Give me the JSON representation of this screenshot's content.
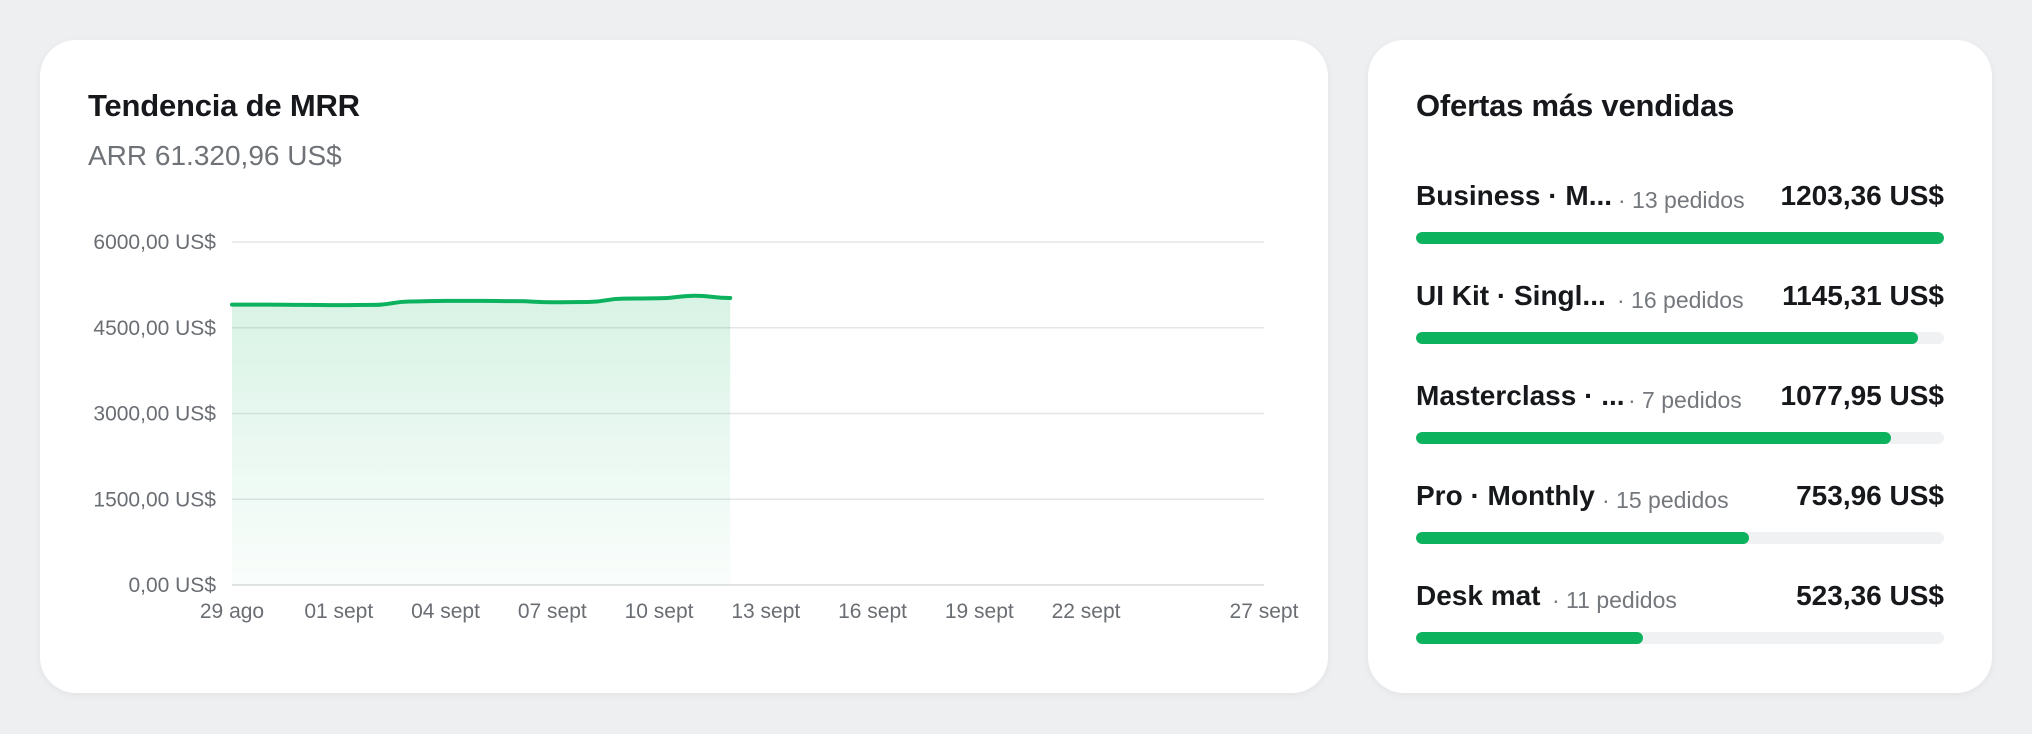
{
  "mrr_card": {
    "title": "Tendencia de MRR",
    "subtitle": "ARR 61.320,96 US$"
  },
  "chart_data": {
    "type": "area",
    "title": "Tendencia de MRR",
    "x_ticks": [
      "29 ago",
      "01 sept",
      "04 sept",
      "07 sept",
      "10 sept",
      "13 sept",
      "16 sept",
      "19 sept",
      "22 sept",
      "27 sept"
    ],
    "y_ticks": [
      "0,00 US$",
      "1500,00 US$",
      "3000,00 US$",
      "4500,00 US$",
      "6000,00 US$"
    ],
    "ylim": [
      0,
      6000
    ],
    "x_range": [
      "29 ago",
      "27 sept"
    ],
    "grid": true,
    "color": "#0cb25e",
    "series": [
      {
        "x": [
          "29 ago",
          "30 ago",
          "31 ago",
          "01 sept",
          "02 sept",
          "03 sept",
          "04 sept",
          "05 sept",
          "06 sept",
          "07 sept",
          "08 sept",
          "09 sept",
          "10 sept",
          "11 sept",
          "12 sept"
        ],
        "values": [
          4905,
          4905,
          4900,
          4895,
          4900,
          4960,
          4970,
          4970,
          4965,
          4945,
          4950,
          5010,
          5015,
          5060,
          5020
        ]
      }
    ]
  },
  "offers_card": {
    "title": "Ofertas más vendidas",
    "items": [
      {
        "name": "Business · M...",
        "orders": "· 13 pedidos",
        "amount": "1203,36 US$",
        "share": 1.0
      },
      {
        "name": "UI Kit · Singl...",
        "orders": "· 16 pedidos",
        "amount": "1145,31 US$",
        "share": 0.95
      },
      {
        "name": "Masterclass · ...",
        "orders": "· 7 pedidos",
        "amount": "1077,95 US$",
        "share": 0.9
      },
      {
        "name": "Pro · Monthly",
        "orders": "· 15 pedidos",
        "amount": "753,96 US$",
        "share": 0.63
      },
      {
        "name": "Desk mat",
        "orders": "· 11 pedidos",
        "amount": "523,36 US$",
        "share": 0.43
      }
    ],
    "bar_color": "#0cb25e",
    "track_color": "#f0f1f2"
  }
}
